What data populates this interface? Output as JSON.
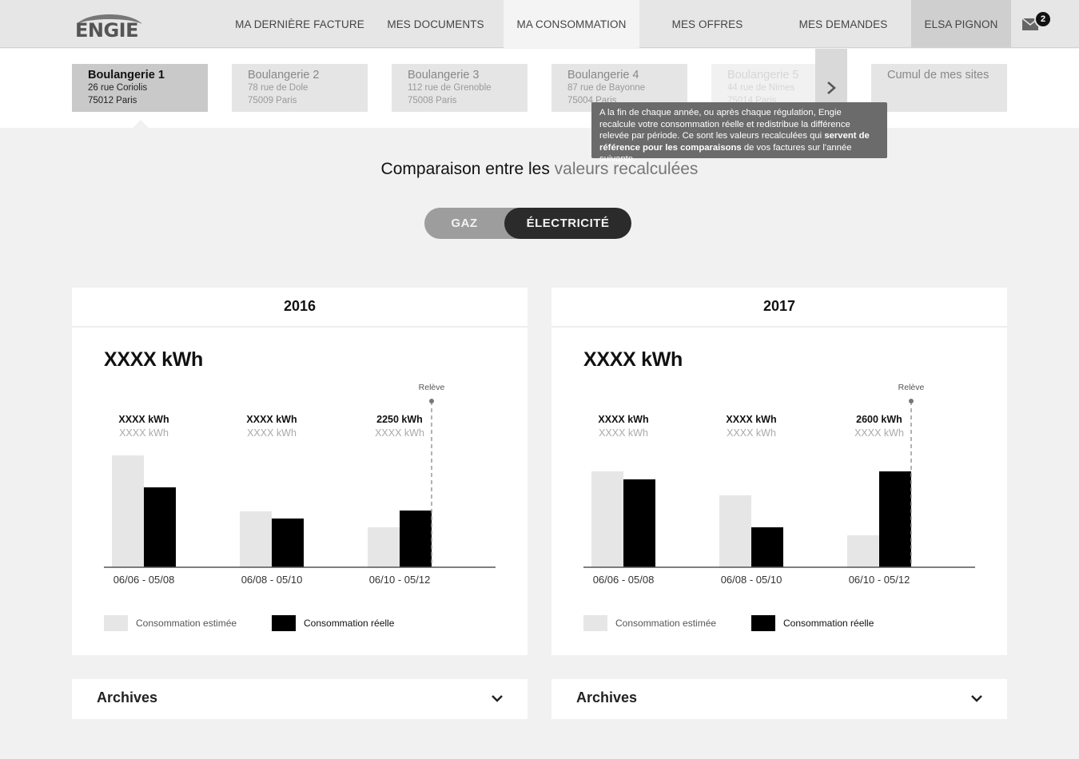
{
  "nav": {
    "logo": "ENGIE",
    "items": [
      "MA DERNIÈRE FACTURE",
      "MES DOCUMENTS",
      "MA CONSOMMATION",
      "MES OFFRES",
      "MES DEMANDES"
    ],
    "user": "ELSA PIGNON",
    "mail_count": "2"
  },
  "sites": [
    {
      "name": "Boulangerie 1",
      "street": "26 rue Coriolis",
      "city": "75012 Paris"
    },
    {
      "name": "Boulangerie 2",
      "street": "78 rue de Dole",
      "city": "75009 Paris"
    },
    {
      "name": "Boulangerie 3",
      "street": "112 rue de Grenoble",
      "city": "75008 Paris"
    },
    {
      "name": "Boulangerie 4",
      "street": "87 rue de Bayonne",
      "city": "75004 Paris"
    },
    {
      "name": "Boulangerie 5",
      "street": "44 rue de Nimes",
      "city": "75014 Paris"
    }
  ],
  "cumul_label": "Cumul de mes sites",
  "tooltip": {
    "part1": "A la fin de chaque année, ou après chaque régulation, Engie recalcule votre consommation réelle et redistribue la différence relevée par période. Ce sont les valeurs recalculées qui ",
    "bold": "servent de référence pour les comparaisons",
    "part2": " de vos factures sur l'année suivante."
  },
  "heading": {
    "prefix": "Comparaison entre les",
    "highlight": "valeurs recalculées"
  },
  "toggle": {
    "gaz": "GAZ",
    "elec": "ÉLECTRICITÉ"
  },
  "legend": {
    "estimated": "Consommation estimée",
    "real": "Consommation réelle"
  },
  "colors": {
    "estimated": "#e6e6e6",
    "real": "#000000"
  },
  "archives_label": "Archives",
  "chart_data": [
    {
      "type": "bar",
      "title": "2016",
      "total": "XXXX kWh",
      "categories": [
        "06/06 - 05/08",
        "06/08 - 05/10",
        "06/10 - 05/12"
      ],
      "series": [
        {
          "name": "Consommation estimée",
          "values": [
            140,
            70,
            50
          ]
        },
        {
          "name": "Consommation réelle",
          "values": [
            100,
            61,
            71
          ]
        }
      ],
      "labels_real": [
        "XXXX kWh",
        "XXXX kWh",
        "2250 kWh"
      ],
      "labels_est": [
        "XXXX kWh",
        "XXXX kWh",
        "XXXX kWh"
      ],
      "marker": {
        "label": "Relève",
        "category": 2
      },
      "ylim": [
        0,
        140
      ]
    },
    {
      "type": "bar",
      "title": "2017",
      "total": "XXXX kWh",
      "categories": [
        "06/06 - 05/08",
        "06/08 - 05/10",
        "06/10 - 05/12"
      ],
      "series": [
        {
          "name": "Consommation estimée",
          "values": [
            120,
            90,
            40
          ]
        },
        {
          "name": "Consommation réelle",
          "values": [
            110,
            50,
            120
          ]
        }
      ],
      "labels_real": [
        "XXXX kWh",
        "XXXX kWh",
        "2600 kWh"
      ],
      "labels_est": [
        "XXXX kWh",
        "XXXX kWh",
        "XXXX kWh"
      ],
      "marker": {
        "label": "Relève",
        "category": 2
      },
      "ylim": [
        0,
        140
      ]
    }
  ]
}
